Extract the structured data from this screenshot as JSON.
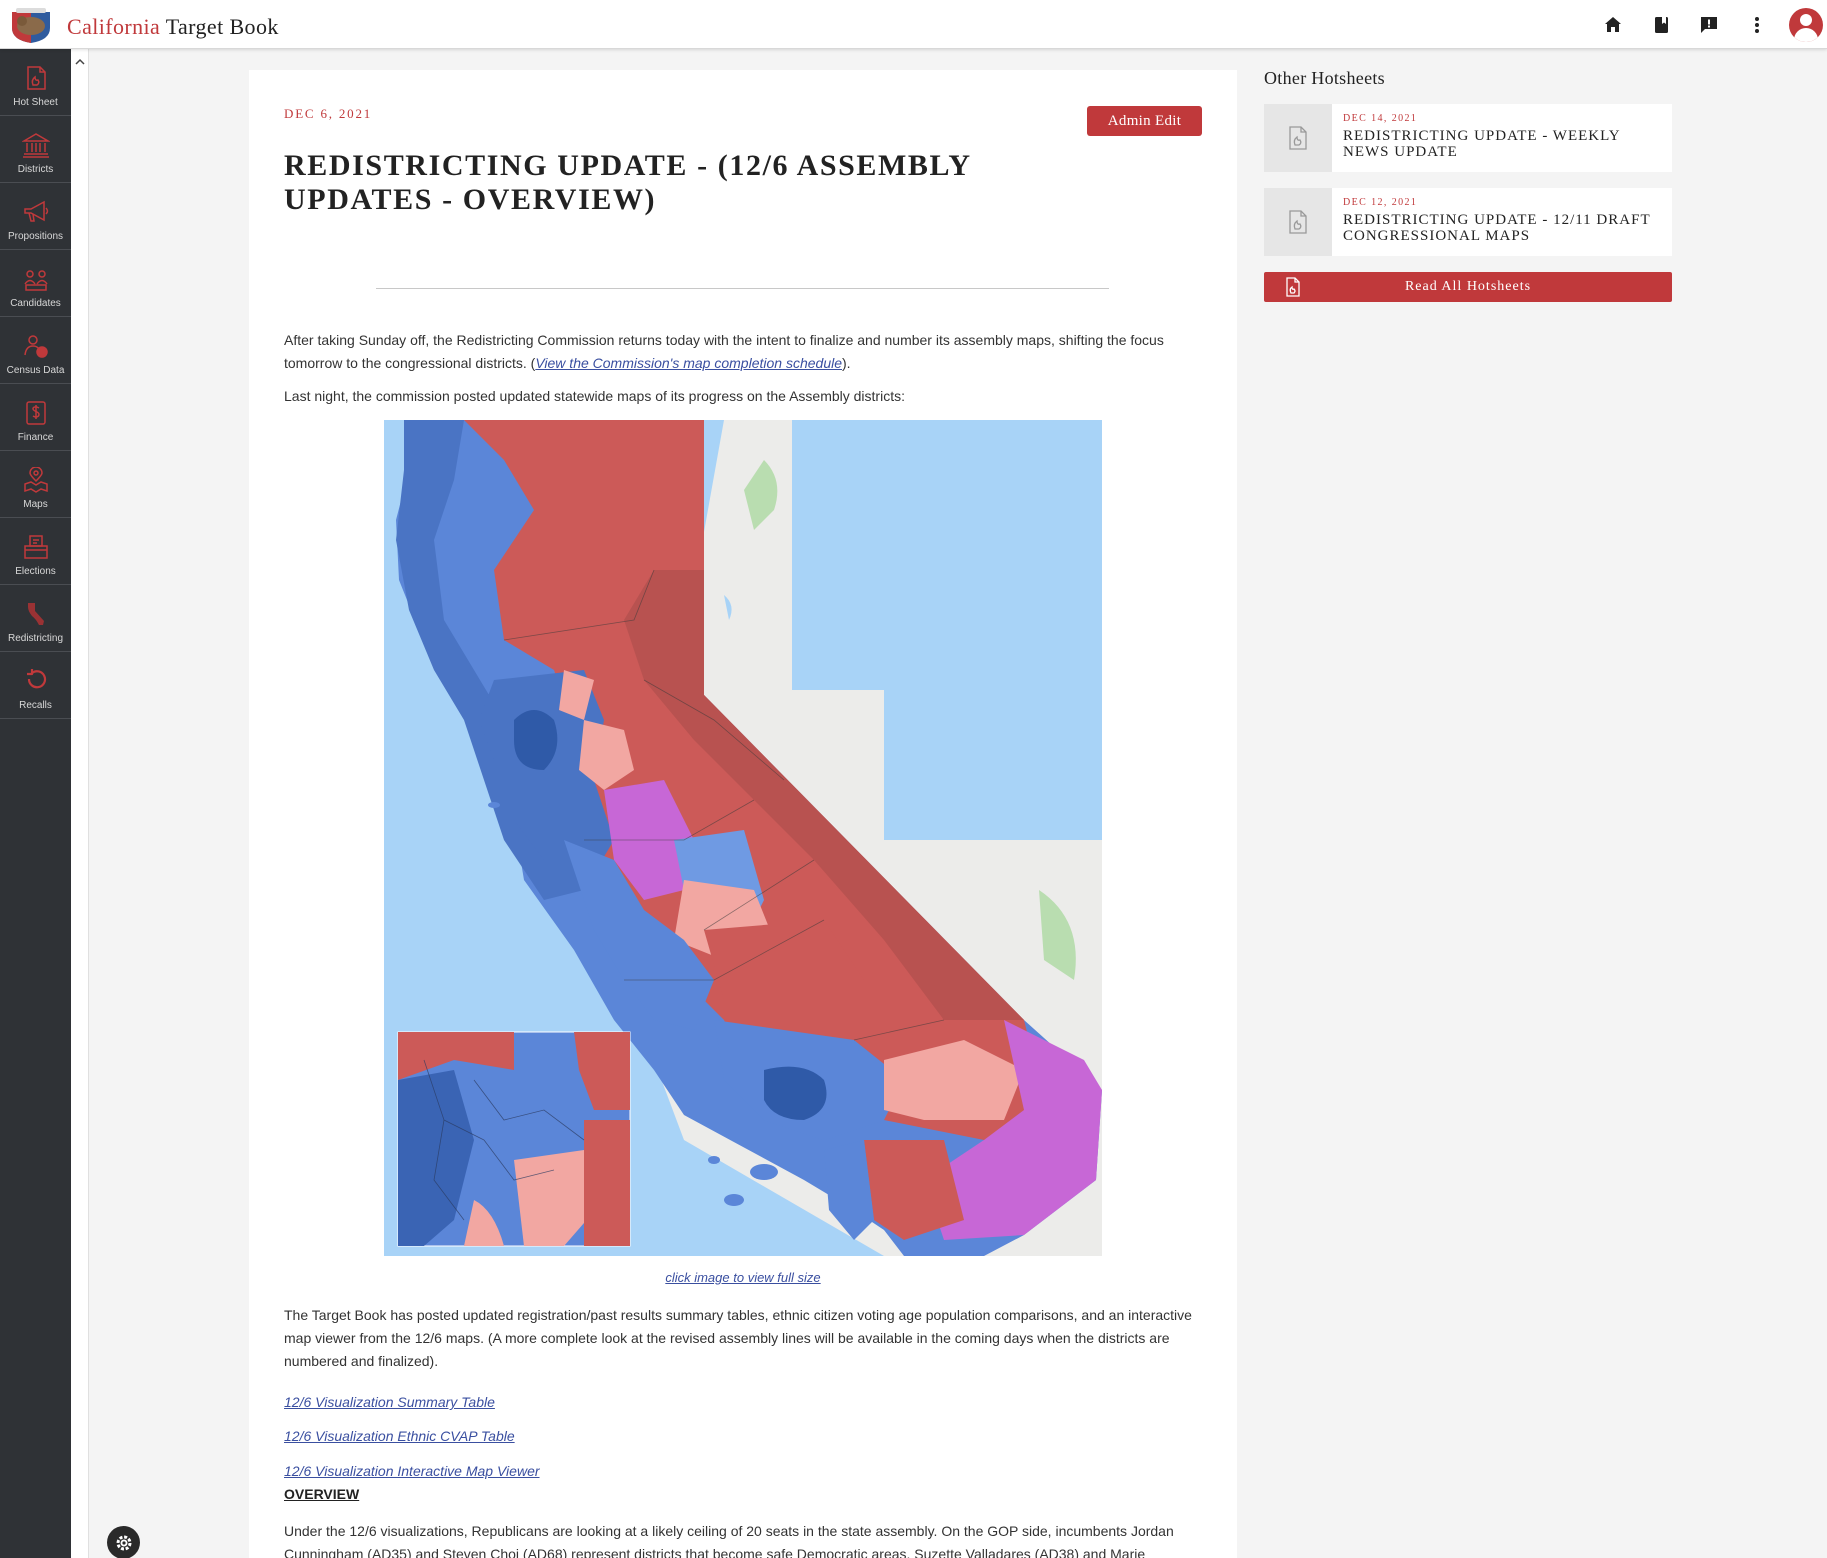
{
  "header": {
    "brand_first": "California",
    "brand_rest": " Target Book"
  },
  "sidebar": {
    "items": [
      {
        "label": "Hot Sheet",
        "icon": "hot-sheet-icon"
      },
      {
        "label": "Districts",
        "icon": "capitol-icon"
      },
      {
        "label": "Propositions",
        "icon": "megaphone-icon"
      },
      {
        "label": "Candidates",
        "icon": "candidates-icon"
      },
      {
        "label": "Census Data",
        "icon": "census-icon"
      },
      {
        "label": "Finance",
        "icon": "dollar-icon"
      },
      {
        "label": "Maps",
        "icon": "map-icon"
      },
      {
        "label": "Elections",
        "icon": "ballot-box-icon"
      },
      {
        "label": "Redistricting",
        "icon": "california-icon"
      },
      {
        "label": "Recalls",
        "icon": "recall-icon"
      }
    ]
  },
  "article": {
    "date": "DEC 6, 2021",
    "admin_label": "Admin Edit",
    "title": "REDISTRICTING UPDATE - (12/6 ASSEMBLY UPDATES - OVERVIEW)",
    "p1_a": "After taking Sunday off, the Redistricting Commission returns today with the intent to finalize and number its assembly maps, shifting the focus tomorrow to the congressional districts. (",
    "p1_link": "View the Commission's map completion schedule",
    "p1_b": ").",
    "p2": "Last night, the commission posted updated statewide maps of its progress on the Assembly districts:",
    "caption": "click image to view full size",
    "p3": "The Target Book has posted updated registration/past results summary tables, ethnic citizen voting age population comparisons, and an interactive map viewer from the 12/6 maps. (A more complete look at the revised assembly lines will be available in the coming days when the districts are numbered and finalized).",
    "link1": "12/6 Visualization Summary Table",
    "link2": "12/6 Visualization Ethnic CVAP Table",
    "link3": "12/6 Visualization Interactive Map Viewer",
    "overview": "OVERVIEW",
    "p4": "Under the 12/6 visualizations, Republicans are looking at a likely ceiling of 20 seats in the state assembly. On the GOP side, incumbents Jordan Cunningham (AD35) and Steven Choi (AD68) represent districts that become safe Democratic areas. Suzette Valladares (AD38) and Marie"
  },
  "other": {
    "heading": "Other Hotsheets",
    "items": [
      {
        "date": "DEC 14, 2021",
        "title": "REDISTRICTING UPDATE - WEEKLY NEWS UPDATE"
      },
      {
        "date": "DEC 12, 2021",
        "title": "REDISTRICTING UPDATE - 12/11 DRAFT CONGRESSIONAL MAPS"
      }
    ],
    "read_all": "Read All Hotsheets"
  },
  "colors": {
    "accent": "#c0393b",
    "sidebar": "#2f3236",
    "dem": "#5b86d8",
    "rep": "#cc5a58",
    "lean": "#f2a7a2",
    "toss": "#c767d6",
    "ocean": "#a8d3f7"
  }
}
